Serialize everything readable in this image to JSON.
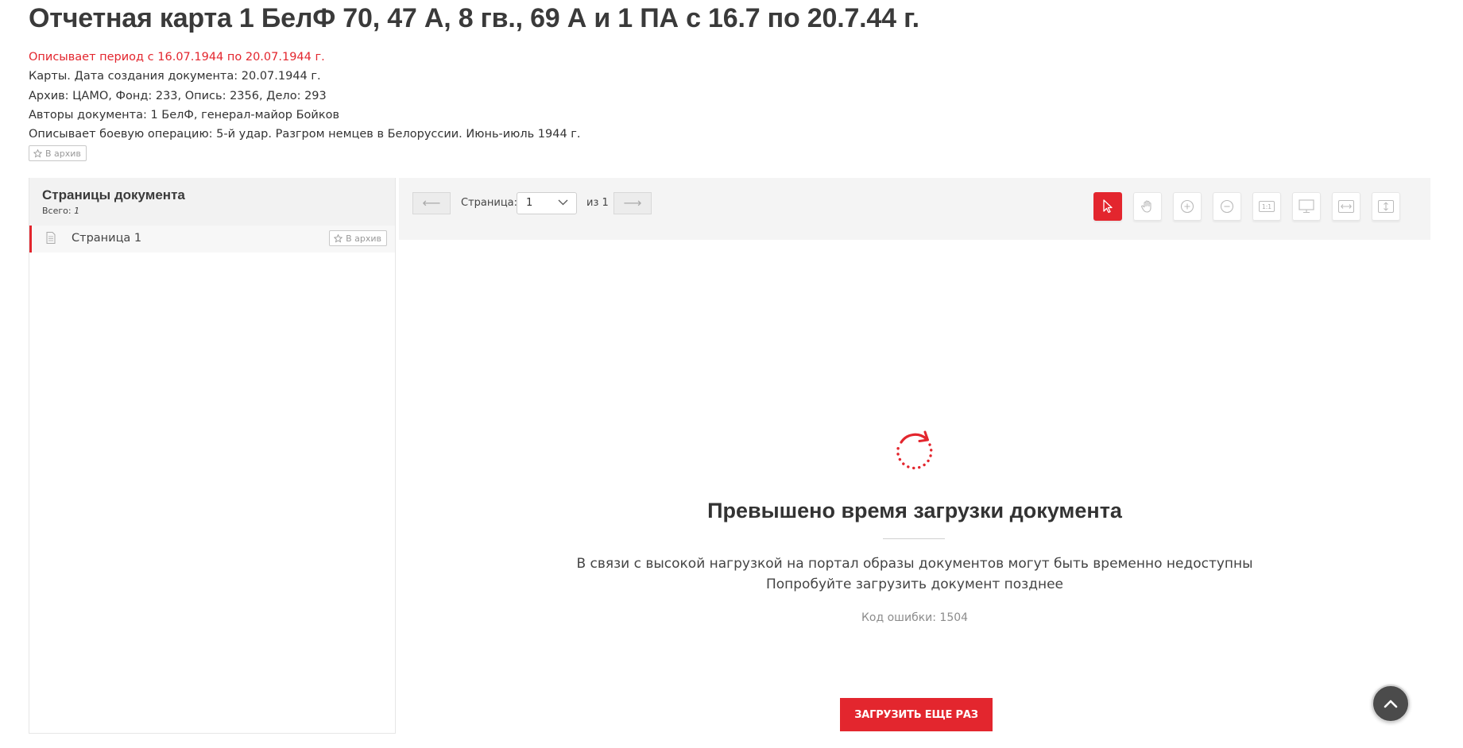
{
  "document": {
    "title": "Отчетная карта 1 БелФ 70, 47 А, 8 гв., 69 А и 1 ПА с 16.7 по 20.7.44 г.",
    "period": "Описывает период с 16.07.1944 по 20.07.1944 г.",
    "created": "Карты. Дата создания документа: 20.07.1944 г.",
    "archive": "Архив: ЦАМО, Фонд: 233, Опись: 2356, Дело: 293",
    "authors": "Авторы документа: 1 БелФ, генерал-майор Бойков",
    "operation": "Описывает боевую операцию: 5-й удар. Разгром немцев в Белоруссии. Июнь-июль 1944 г.",
    "archive_button": "В архив"
  },
  "sidebar": {
    "title": "Страницы документа",
    "total_label": "Всего:",
    "total_value": "1",
    "pages": [
      {
        "label": "Страница 1",
        "archive_button": "В архив"
      }
    ]
  },
  "toolbar": {
    "prev_arrow": "⟵",
    "next_arrow": "⟶",
    "page_label": "Страница:",
    "page_value": "1",
    "of_label": "из 1",
    "tools": [
      "cursor-icon",
      "hand-icon",
      "zoom-in-icon",
      "zoom-out-icon",
      "actual-size-icon",
      "fit-screen-icon",
      "fit-width-icon",
      "fit-height-icon"
    ]
  },
  "error": {
    "title": "Превышено время загрузки документа",
    "text1": "В связи с высокой нагрузкой на портал образы документов могут быть временно недоступны",
    "text2": "Попробуйте загрузить документ позднее",
    "code": "Код ошибки: 1504",
    "retry_button": "ЗАГРУЗИТЬ ЕЩЕ РАЗ"
  },
  "colors": {
    "accent": "#e3262e",
    "toolbar_bg": "#f4f4f4",
    "text": "#333333"
  }
}
